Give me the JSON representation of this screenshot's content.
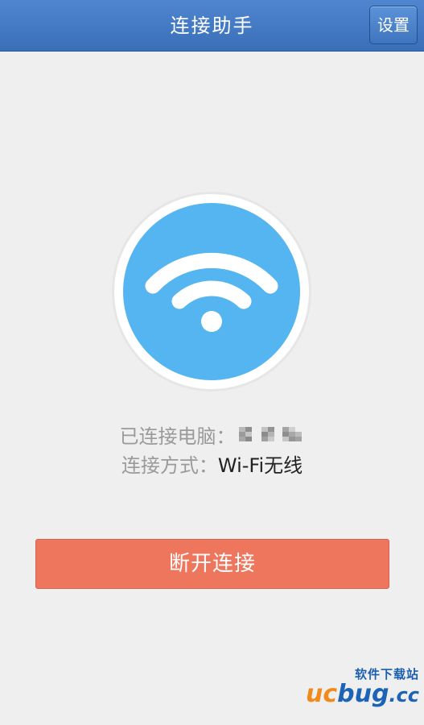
{
  "header": {
    "title": "连接助手",
    "settings_label": "设置"
  },
  "status_icon": {
    "icon": "wifi-icon",
    "circle_color": "#55b5f0",
    "ring_color": "#ffffff"
  },
  "connection": {
    "computer_label": "已连接电脑：",
    "computer_value_redacted": true,
    "method_label": "连接方式：",
    "method_value": "Wi-Fi无线"
  },
  "actions": {
    "disconnect_label": "断开连接",
    "disconnect_color": "#ee765d"
  },
  "watermark": {
    "tagline": "软件下载站",
    "brand_u": "u",
    "brand_c": "c",
    "brand_bug": "bug",
    "brand_tld": ".cc"
  },
  "colors": {
    "header_blue": "#3a6fb8",
    "background": "#efefef"
  }
}
